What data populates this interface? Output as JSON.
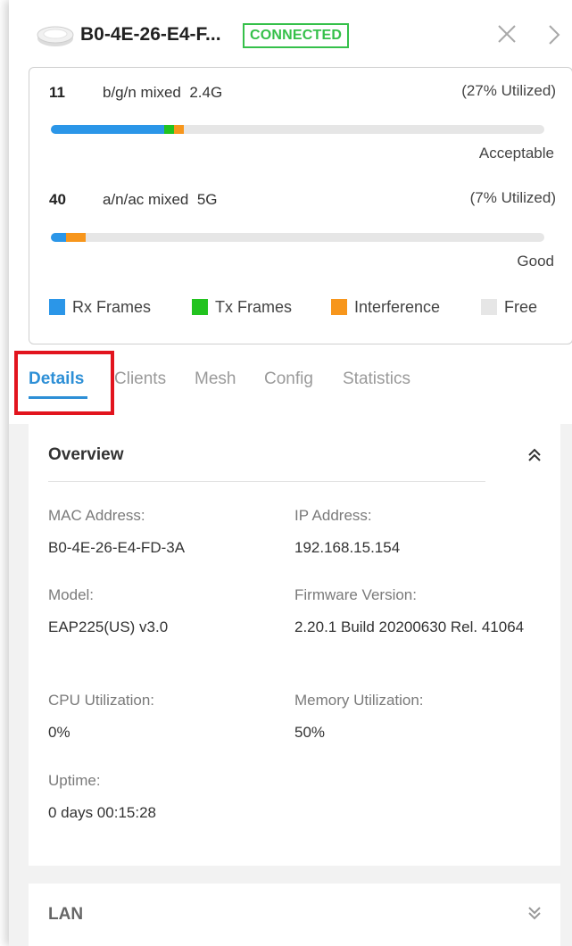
{
  "header": {
    "device_name": "B0-4E-26-E4-F...",
    "status": "CONNECTED"
  },
  "channels": [
    {
      "channel": "11",
      "mode": "b/g/n mixed",
      "band": "2.4G",
      "utilization": "(27% Utilized)",
      "quality": "Acceptable",
      "usage": {
        "rx_frames": 0.23,
        "tx_frames": 0.02,
        "interference": 0.02
      }
    },
    {
      "channel": "40",
      "mode": "a/n/ac mixed",
      "band": "5G",
      "utilization": "(7% Utilized)",
      "quality": "Good",
      "usage": {
        "rx_frames": 0.03,
        "tx_frames": 0.0,
        "interference": 0.04
      }
    }
  ],
  "legend": {
    "rx_frames": "Rx Frames",
    "tx_frames": "Tx Frames",
    "interference": "Interference",
    "free": "Free"
  },
  "colors": {
    "rx_frames": "#2b96e8",
    "tx_frames": "#22c31f",
    "interference": "#f7961c",
    "free": "#e6e6e6",
    "accent": "#2d8fd6",
    "connected": "#35c04a",
    "highlight": "#e2141e"
  },
  "tabs": {
    "details": "Details",
    "clients": "Clients",
    "mesh": "Mesh",
    "config": "Config",
    "statistics": "Statistics",
    "active": "Details"
  },
  "overview": {
    "title": "Overview",
    "mac_label": "MAC Address:",
    "mac_value": "B0-4E-26-E4-FD-3A",
    "ip_label": "IP Address:",
    "ip_value": "192.168.15.154",
    "model_label": "Model:",
    "model_value": "EAP225(US) v3.0",
    "firmware_label": "Firmware Version:",
    "firmware_value": "2.20.1 Build 20200630 Rel. 41064",
    "cpu_label": "CPU Utilization:",
    "cpu_value": "0%",
    "memory_label": "Memory Utilization:",
    "memory_value": "50%",
    "uptime_label": "Uptime:",
    "uptime_value": "0 days 00:15:28"
  },
  "lan": {
    "title": "LAN"
  },
  "icons": {
    "device": "access-point-icon",
    "close": "close-icon",
    "next": "chevron-right-icon",
    "collapse": "double-chevron-up-icon",
    "expand": "double-chevron-down-icon"
  }
}
